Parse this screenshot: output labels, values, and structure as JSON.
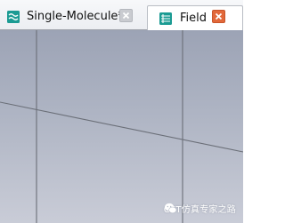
{
  "tabs": [
    {
      "label": "Single-Molecule*",
      "icon": "field-monitor-icon",
      "active": false,
      "close_icon": "close-icon"
    },
    {
      "label": "Field",
      "icon": "field-monitor-icon",
      "active": true,
      "close_icon": "close-icon"
    }
  ],
  "colors": {
    "tab_icon": "#1b9b93",
    "active_close": "#e2683a",
    "inactive_close": "#c9cbd0",
    "viewport_top": "#9ca3b5",
    "viewport_bottom": "#c9ccd7",
    "grid_line": "#6b6f78"
  },
  "viewport": {
    "watermark": "CST仿真专家之路",
    "watermark_icon": "wechat-icon"
  }
}
